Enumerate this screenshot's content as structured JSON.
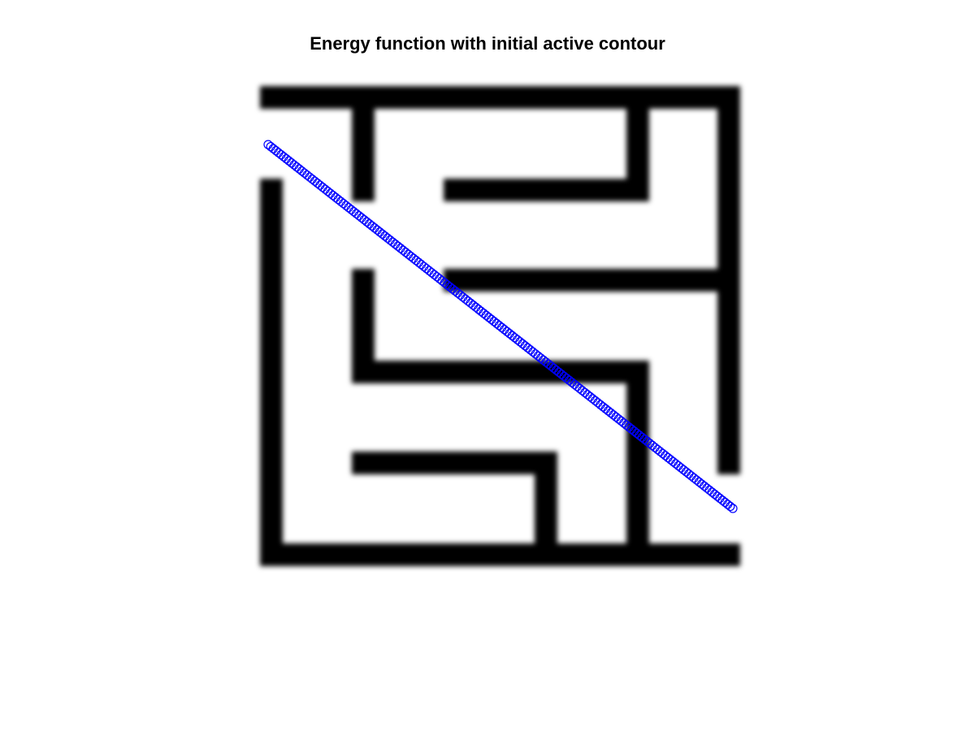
{
  "title": "Energy function with initial active contour",
  "colors": {
    "background": "#ffffff",
    "walls": "#000000",
    "contour": "#0000ff"
  },
  "contour": {
    "marker": "circle",
    "start": "upper-left corner, left of entrance",
    "end": "lower-right corner, right of exit"
  }
}
